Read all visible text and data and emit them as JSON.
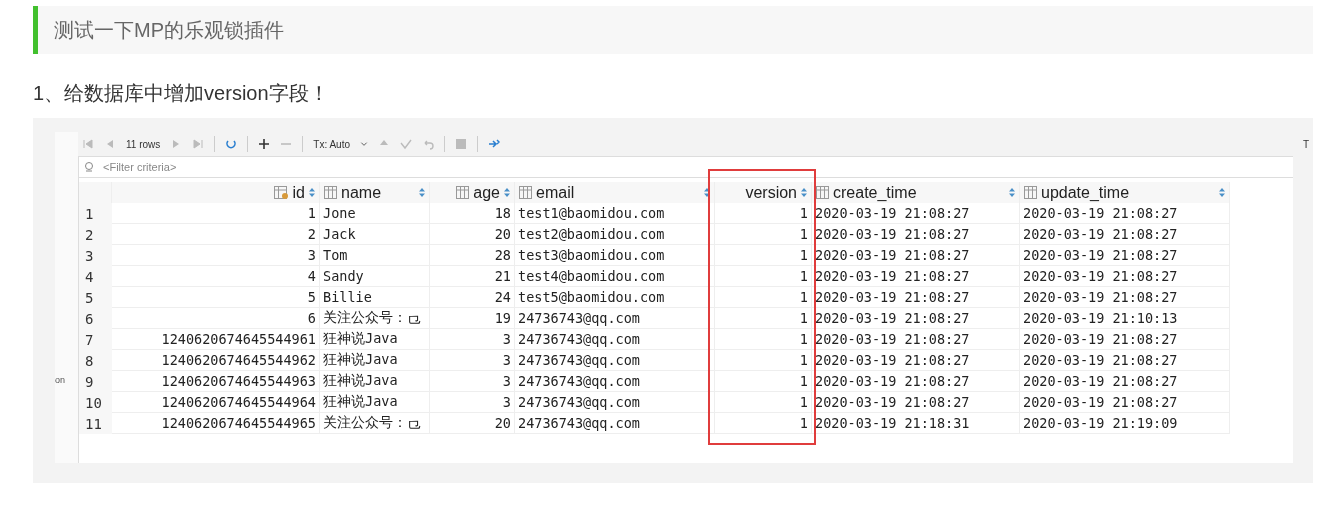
{
  "heading": "测试一下MP的乐观锁插件",
  "step": "1、给数据库中增加version字段！",
  "db_tool": {
    "toolbar": {
      "rows_label": "11 rows",
      "tx_mode": "Tx: Auto",
      "edge_fragment": "T"
    },
    "side_fragment": "on",
    "filter": {
      "placeholder": "<Filter criteria>"
    },
    "table": {
      "columns": [
        {
          "name": "id",
          "kind": "key"
        },
        {
          "name": "name",
          "kind": "column"
        },
        {
          "name": "age",
          "kind": "column"
        },
        {
          "name": "email",
          "kind": "column"
        },
        {
          "name": "version",
          "kind": "plain",
          "highlighted": true
        },
        {
          "name": "create_time",
          "kind": "column"
        },
        {
          "name": "update_time",
          "kind": "column"
        }
      ],
      "rows": [
        {
          "num": "1",
          "cells": [
            "1",
            "Jone",
            "18",
            "test1@baomidou.com",
            "1",
            "2020-03-19 21:08:27",
            "2020-03-19 21:08:27"
          ]
        },
        {
          "num": "2",
          "cells": [
            "2",
            "Jack",
            "20",
            "test2@baomidou.com",
            "1",
            "2020-03-19 21:08:27",
            "2020-03-19 21:08:27"
          ]
        },
        {
          "num": "3",
          "cells": [
            "3",
            "Tom",
            "28",
            "test3@baomidou.com",
            "1",
            "2020-03-19 21:08:27",
            "2020-03-19 21:08:27"
          ]
        },
        {
          "num": "4",
          "cells": [
            "4",
            "Sandy",
            "21",
            "test4@baomidou.com",
            "1",
            "2020-03-19 21:08:27",
            "2020-03-19 21:08:27"
          ]
        },
        {
          "num": "5",
          "cells": [
            "5",
            "Billie",
            "24",
            "test5@baomidou.com",
            "1",
            "2020-03-19 21:08:27",
            "2020-03-19 21:08:27"
          ]
        },
        {
          "num": "6",
          "cells": [
            "6",
            "关注公众号：⺋",
            "19",
            "24736743@qq.com",
            "1",
            "2020-03-19 21:08:27",
            "2020-03-19 21:10:13"
          ]
        },
        {
          "num": "7",
          "cells": [
            "1240620674645544961",
            "狂神说Java",
            "3",
            "24736743@qq.com",
            "1",
            "2020-03-19 21:08:27",
            "2020-03-19 21:08:27"
          ]
        },
        {
          "num": "8",
          "cells": [
            "1240620674645544962",
            "狂神说Java",
            "3",
            "24736743@qq.com",
            "1",
            "2020-03-19 21:08:27",
            "2020-03-19 21:08:27"
          ]
        },
        {
          "num": "9",
          "cells": [
            "1240620674645544963",
            "狂神说Java",
            "3",
            "24736743@qq.com",
            "1",
            "2020-03-19 21:08:27",
            "2020-03-19 21:08:27"
          ]
        },
        {
          "num": "10",
          "cells": [
            "1240620674645544964",
            "狂神说Java",
            "3",
            "24736743@qq.com",
            "1",
            "2020-03-19 21:08:27",
            "2020-03-19 21:08:27"
          ]
        },
        {
          "num": "11",
          "cells": [
            "1240620674645544965",
            "关注公众号：⺋",
            "20",
            "24736743@qq.com",
            "1",
            "2020-03-19 21:18:31",
            "2020-03-19 21:19:09"
          ]
        }
      ]
    }
  }
}
